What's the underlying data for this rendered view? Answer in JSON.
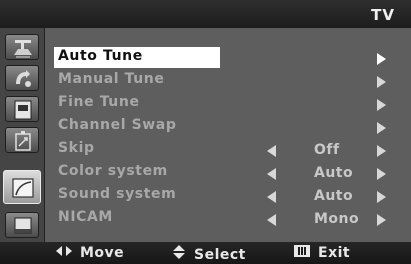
{
  "header": {
    "title": "TV"
  },
  "sidebar": {
    "icons": [
      {
        "name": "picture-icon",
        "active": false
      },
      {
        "name": "sound-icon",
        "active": false
      },
      {
        "name": "channel-icon",
        "active": false
      },
      {
        "name": "setup-icon",
        "active": false
      },
      {
        "name": "input-icon",
        "active": true
      },
      {
        "name": "application-icon",
        "active": false
      }
    ]
  },
  "menu": {
    "items": [
      {
        "label": "Auto Tune",
        "value": "",
        "left_arrow": false,
        "selected": true
      },
      {
        "label": "Manual Tune",
        "value": "",
        "left_arrow": false,
        "selected": false
      },
      {
        "label": "Fine Tune",
        "value": "",
        "left_arrow": false,
        "selected": false
      },
      {
        "label": "Channel Swap",
        "value": "",
        "left_arrow": false,
        "selected": false
      },
      {
        "label": "Skip",
        "value": "Off",
        "left_arrow": true,
        "selected": false
      },
      {
        "label": "Color system",
        "value": "Auto",
        "left_arrow": true,
        "selected": false
      },
      {
        "label": "Sound system",
        "value": "Auto",
        "left_arrow": true,
        "selected": false
      },
      {
        "label": "NICAM",
        "value": "Mono",
        "left_arrow": true,
        "selected": false
      }
    ]
  },
  "footer": {
    "move_label": "Move",
    "select_label": "Select",
    "exit_label": "Exit"
  },
  "colors": {
    "menu_bg": "#5e5e5e",
    "label_text": "#a8a8a8",
    "selected_bg": "#ffffff",
    "bar_bg": "#1d1d1d"
  }
}
